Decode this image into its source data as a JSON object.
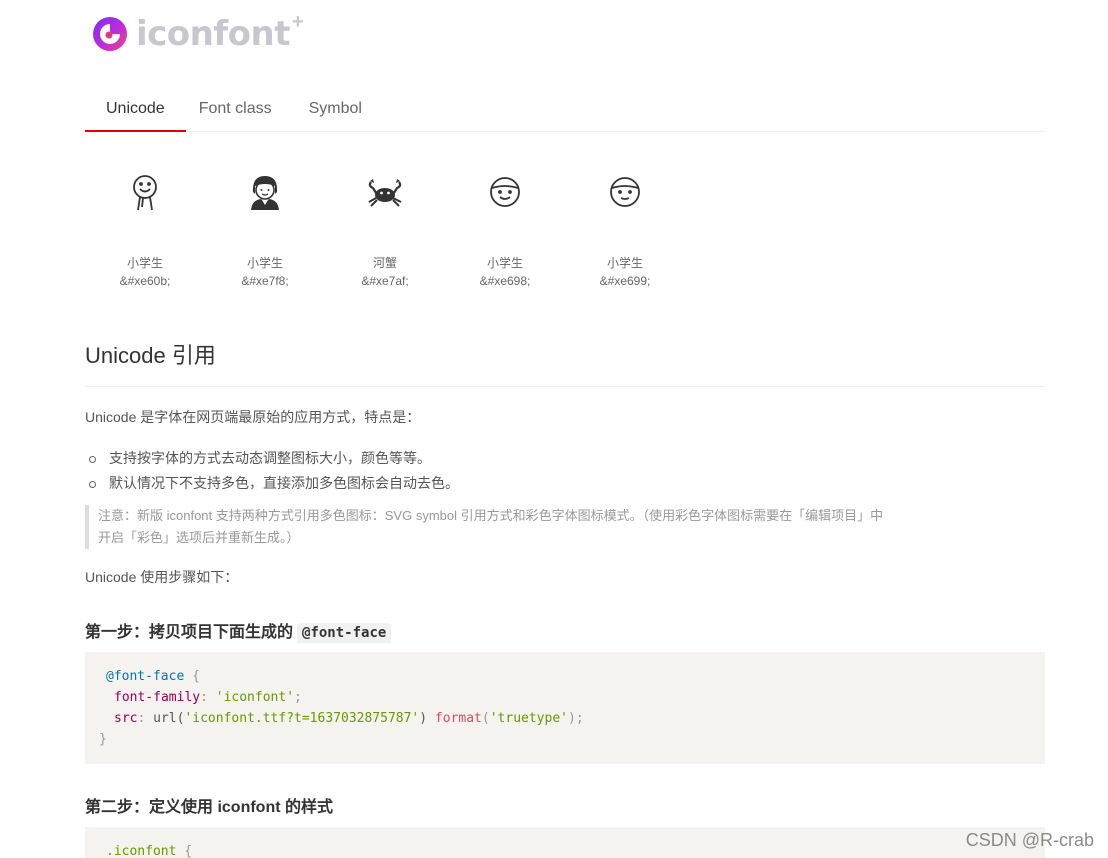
{
  "logo": {
    "text": "iconfont",
    "plus": "+"
  },
  "tabs": [
    {
      "label": "Unicode",
      "active": true
    },
    {
      "label": "Font class",
      "active": false
    },
    {
      "label": "Symbol",
      "active": false
    }
  ],
  "icons": [
    {
      "name": "小学生",
      "code": "&#xe60b;",
      "icon": "stick-figure-icon"
    },
    {
      "name": "小学生",
      "code": "&#xe7f8;",
      "icon": "student-girl-icon"
    },
    {
      "name": "河蟹",
      "code": "&#xe7af;",
      "icon": "crab-icon"
    },
    {
      "name": "小学生",
      "code": "&#xe698;",
      "icon": "face-icon"
    },
    {
      "name": "小学生",
      "code": "&#xe699;",
      "icon": "face-icon"
    }
  ],
  "section": {
    "title": "Unicode 引用",
    "intro": "Unicode 是字体在网页端最原始的应用方式，特点是：",
    "bullets": [
      "支持按字体的方式去动态调整图标大小，颜色等等。",
      "默认情况下不支持多色，直接添加多色图标会自动去色。"
    ],
    "note_line1": "注意：新版 iconfont 支持两种方式引用多色图标：SVG symbol 引用方式和彩色字体图标模式。（使用彩色字体图标需要在「编辑项目」中",
    "note_line2": "开启「彩色」选项后并重新生成。）",
    "steps_intro": "Unicode 使用步骤如下：",
    "step1_title": "第一步：拷贝项目下面生成的",
    "step1_code": "@font-face",
    "step2_title": "第二步：定义使用 iconfont 的样式"
  },
  "code1": {
    "at": "@font-face",
    "open": " {",
    "l2_prop": "font-family",
    "l2_colon": ": ",
    "l2_val": "'iconfont'",
    "l2_end": ";",
    "l3_prop": "src",
    "l3_colon": ": ",
    "l3_url": "url(",
    "l3_url_val": "'iconfont.ttf?t=1637032875787'",
    "l3_url_close": ") ",
    "l3_fn": "format",
    "l3_fn_open": "(",
    "l3_fn_val": "'truetype'",
    "l3_end": ");",
    "close": "}"
  },
  "code2": {
    "selector": ".iconfont",
    "open": " {"
  },
  "watermark": "CSDN @R-crab"
}
